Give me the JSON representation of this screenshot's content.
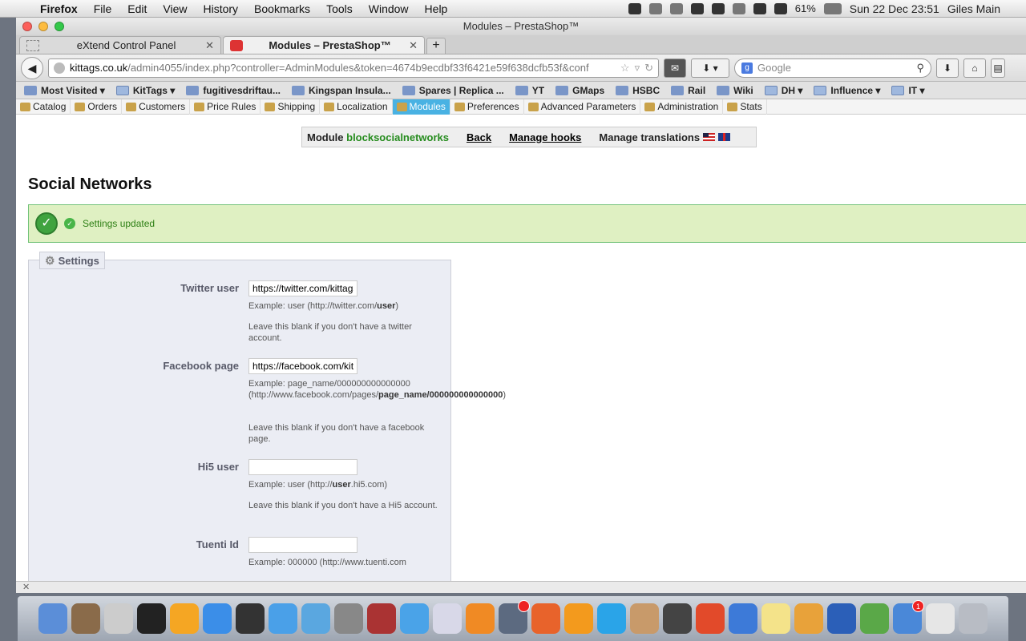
{
  "menubar": {
    "app_name": "Firefox",
    "items": [
      "File",
      "Edit",
      "View",
      "History",
      "Bookmarks",
      "Tools",
      "Window",
      "Help"
    ],
    "battery": "61%",
    "clock": "Sun 22 Dec  23:51",
    "user": "Giles Main"
  },
  "window": {
    "title": "Modules – PrestaShop™"
  },
  "tabs": [
    {
      "label": "eXtend Control Panel",
      "active": false
    },
    {
      "label": "Modules – PrestaShop™",
      "active": true
    }
  ],
  "url": {
    "host": "kittags.co.uk",
    "path": "/admin4055/index.php?controller=AdminModules&token=4674b9ecdbf33f6421e59f638dcfb53f&conf"
  },
  "search": {
    "placeholder": "Google"
  },
  "bookmarks": [
    {
      "label": "Most Visited ▾",
      "icon": "most-visited-icon"
    },
    {
      "label": "KitTags ▾",
      "icon": "folder-icon"
    },
    {
      "label": "fugitivesdriftau...",
      "icon": "site-icon"
    },
    {
      "label": "Kingspan Insula...",
      "icon": "site-icon"
    },
    {
      "label": "Spares | Replica ...",
      "icon": "site-icon"
    },
    {
      "label": "YT",
      "icon": "youtube-icon"
    },
    {
      "label": "GMaps",
      "icon": "maps-icon"
    },
    {
      "label": "HSBC",
      "icon": "hsbc-icon"
    },
    {
      "label": "Rail",
      "icon": "rail-icon"
    },
    {
      "label": "Wiki",
      "icon": "wiki-icon"
    },
    {
      "label": "DH ▾",
      "icon": "folder-icon"
    },
    {
      "label": "Influence ▾",
      "icon": "folder-icon"
    },
    {
      "label": "IT ▾",
      "icon": "folder-icon"
    }
  ],
  "ps_menu": [
    {
      "label": "Catalog",
      "active": false
    },
    {
      "label": "Orders",
      "active": false
    },
    {
      "label": "Customers",
      "active": false
    },
    {
      "label": "Price Rules",
      "active": false
    },
    {
      "label": "Shipping",
      "active": false
    },
    {
      "label": "Localization",
      "active": false
    },
    {
      "label": "Modules",
      "active": true
    },
    {
      "label": "Preferences",
      "active": false
    },
    {
      "label": "Advanced Parameters",
      "active": false
    },
    {
      "label": "Administration",
      "active": false
    },
    {
      "label": "Stats",
      "active": false
    }
  ],
  "module_toolbar": {
    "prefix": "Module",
    "module_name": "blocksocialnetworks",
    "back": "Back",
    "manage_hooks": "Manage hooks",
    "manage_translations": "Manage translations"
  },
  "page_title": "Social Networks",
  "confirmation": "Settings updated",
  "settings": {
    "legend": "Settings",
    "twitter": {
      "label": "Twitter user",
      "value": "https://twitter.com/kittags",
      "hint1_pre": "Example: user (http://twitter.com/",
      "hint1_bold": "user",
      "hint1_post": ")",
      "hint2": "Leave this blank if you don't have a twitter account."
    },
    "facebook": {
      "label": "Facebook page",
      "value": "https://facebook.com/kittags",
      "hint1_pre": "Example: page_name/000000000000000 (http://www.facebook.com/pages/",
      "hint1_bold": "page_name/000000000000000",
      "hint1_post": ")",
      "hint2": "Leave this blank if you don't have a facebook page."
    },
    "hi5": {
      "label": "Hi5 user",
      "value": "",
      "hint1_pre": "Example: user (http://",
      "hint1_bold": "user",
      "hint1_post": ".hi5.com)",
      "hint2": "Leave this blank if you don't have a Hi5 account."
    },
    "tuenti": {
      "label": "Tuenti Id",
      "value": "",
      "hint1_pre": "Example: 000000 (http://www.tuenti.com"
    }
  },
  "colors": {
    "active_tab": "#49b2e3",
    "module_name": "#268c1e",
    "success_bg": "#dff0c2",
    "fieldset_bg": "#ebedf4"
  },
  "dock": [
    {
      "icon": "finder-icon"
    },
    {
      "icon": "photo-booth-icon"
    },
    {
      "icon": "dvd-player-icon"
    },
    {
      "icon": "aperture-icon"
    },
    {
      "icon": "orange-o-icon"
    },
    {
      "icon": "app-store-icon"
    },
    {
      "icon": "dashboard-icon"
    },
    {
      "icon": "itunes-icon"
    },
    {
      "icon": "safari-icon"
    },
    {
      "icon": "system-preferences-icon"
    },
    {
      "icon": "photo-stack-icon"
    },
    {
      "icon": "twitter-icon"
    },
    {
      "icon": "preview-icon"
    },
    {
      "icon": "ibooks-icon"
    },
    {
      "icon": "facetime-icon",
      "badge": ""
    },
    {
      "icon": "firefox-icon"
    },
    {
      "icon": "vlc-icon"
    },
    {
      "icon": "skype-icon"
    },
    {
      "icon": "contacts-icon"
    },
    {
      "icon": "imovie-icon"
    },
    {
      "icon": "powerpoint-icon"
    },
    {
      "icon": "numbers-icon"
    },
    {
      "icon": "stickies-icon"
    },
    {
      "icon": "pages-icon"
    },
    {
      "icon": "word-icon"
    },
    {
      "icon": "time-machine-icon"
    },
    {
      "icon": "mail-icon",
      "badge": "1"
    },
    {
      "icon": "pdf-document-icon"
    },
    {
      "icon": "trash-icon"
    }
  ]
}
